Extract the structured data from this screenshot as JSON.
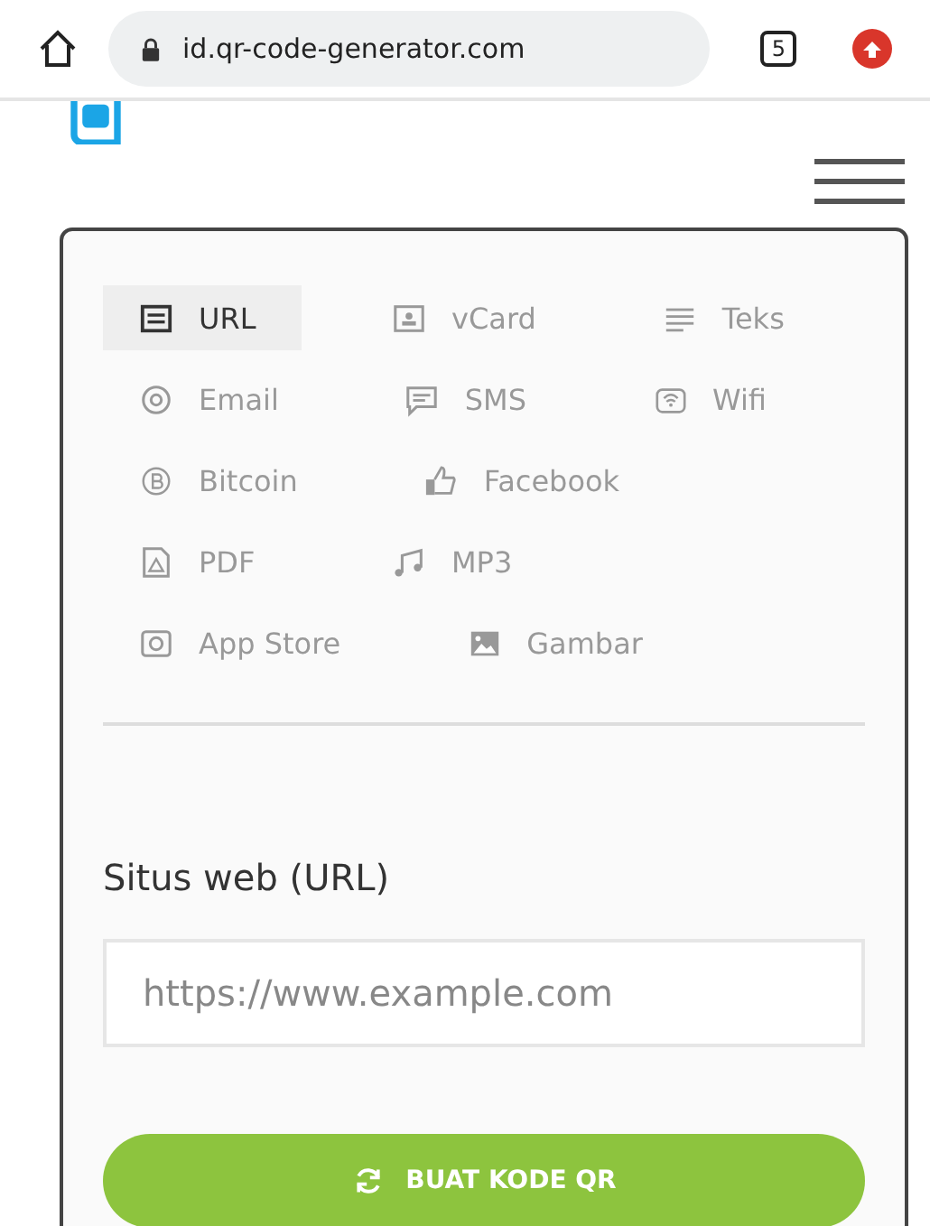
{
  "browser": {
    "url": "id.qr-code-generator.com",
    "tab_count": "5"
  },
  "type_rows": [
    [
      {
        "label": "URL",
        "kind": "url",
        "selected": true
      },
      {
        "label": "vCard",
        "kind": "vcard",
        "selected": false
      },
      {
        "label": "Teks",
        "kind": "text",
        "selected": false
      }
    ],
    [
      {
        "label": "Email",
        "kind": "email",
        "selected": false
      },
      {
        "label": "SMS",
        "kind": "sms",
        "selected": false
      },
      {
        "label": "Wifi",
        "kind": "wifi",
        "selected": false
      }
    ],
    [
      {
        "label": "Bitcoin",
        "kind": "bitcoin",
        "selected": false
      },
      {
        "label": "Facebook",
        "kind": "facebook",
        "selected": false
      }
    ],
    [
      {
        "label": "PDF",
        "kind": "pdf",
        "selected": false
      },
      {
        "label": "MP3",
        "kind": "mp3",
        "selected": false
      }
    ],
    [
      {
        "label": "App Store",
        "kind": "appstore",
        "selected": false
      },
      {
        "label": "Gambar",
        "kind": "image",
        "selected": false
      }
    ]
  ],
  "form": {
    "label": "Situs web (URL)",
    "placeholder": "https://www.example.com"
  },
  "generate_button": "BUAT KODE QR"
}
